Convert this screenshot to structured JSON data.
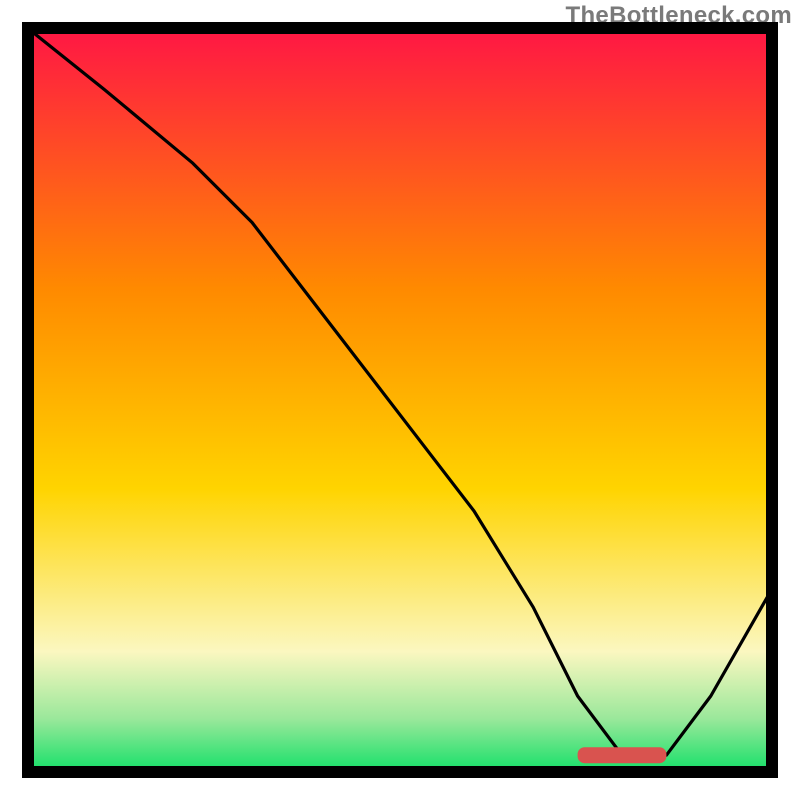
{
  "watermark": "TheBottleneck.com",
  "colors": {
    "frame": "#000000",
    "curve": "#000000",
    "marker_fill": "#d9534f",
    "gradient_top": "#ff1744",
    "gradient_mid_upper": "#ff8a00",
    "gradient_mid": "#ffd400",
    "gradient_low": "#fbf7c0",
    "gradient_green_light": "#9be89b",
    "gradient_green": "#19e06a"
  },
  "chart_data": {
    "type": "line",
    "title": "",
    "xlabel": "",
    "ylabel": "",
    "xlim": [
      0,
      100
    ],
    "ylim": [
      0,
      100
    ],
    "legend": [],
    "annotations": [],
    "x": [
      0,
      10,
      22,
      30,
      40,
      50,
      60,
      68,
      74,
      80,
      86,
      92,
      100
    ],
    "values": [
      100,
      92,
      82,
      74,
      61,
      48,
      35,
      22,
      10,
      2,
      2,
      10,
      24
    ],
    "optimum_marker": {
      "x_start": 74,
      "x_end": 86,
      "y": 2
    }
  }
}
